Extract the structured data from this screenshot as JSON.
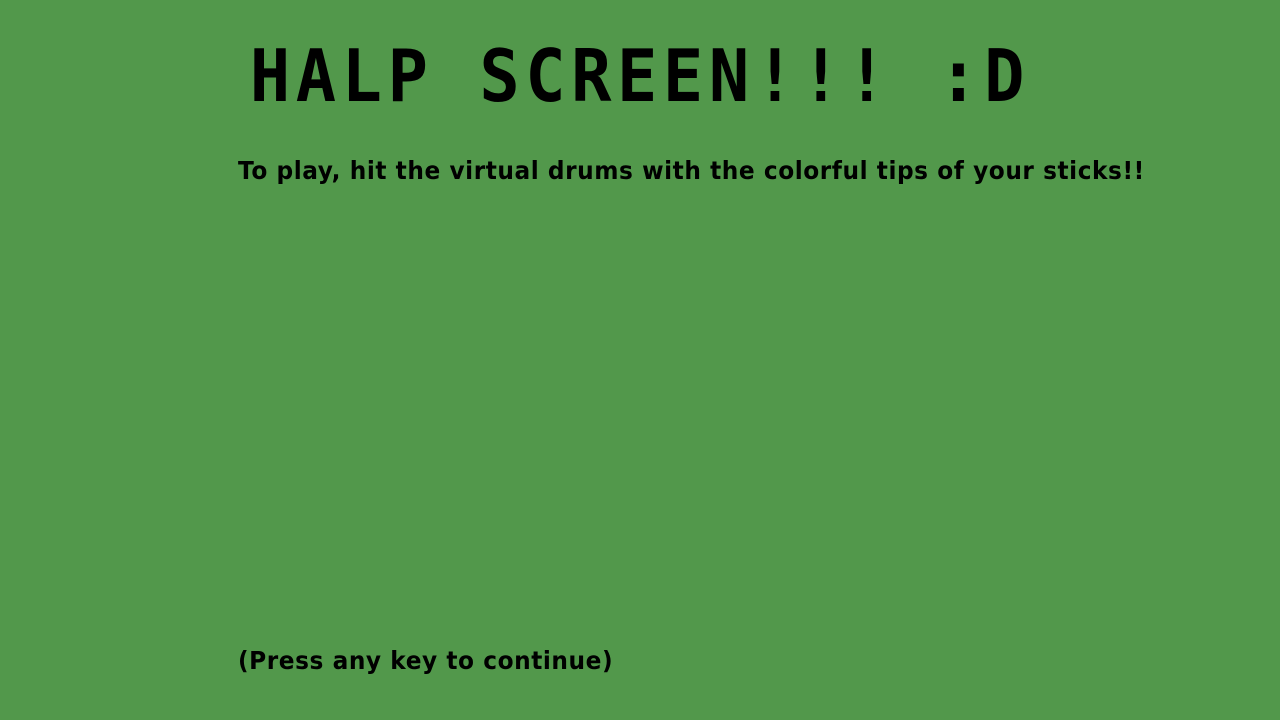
{
  "screen": {
    "title": "HALP SCREEN!!! :D",
    "instructions": "To play, hit the virtual drums with the colorful tips of your sticks!!",
    "continue_prompt": "(Press any key to continue)"
  },
  "colors": {
    "background": "#52984b",
    "text": "#000000"
  }
}
